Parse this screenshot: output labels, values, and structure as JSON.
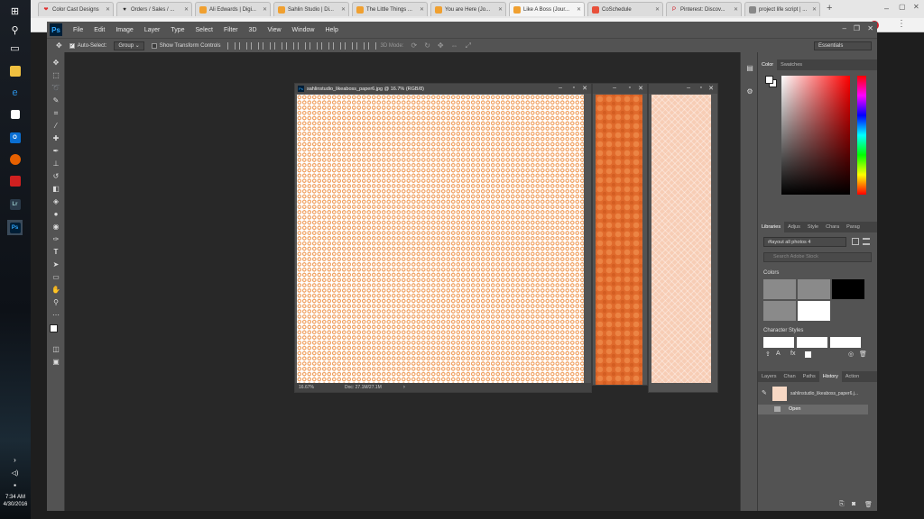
{
  "taskbar": {
    "time": "7:34 AM",
    "date": "4/30/2016",
    "apps": [
      "windows-start",
      "search",
      "task-view",
      "chrome",
      "edge",
      "store",
      "outlook",
      "firefox",
      "app-red",
      "lightroom",
      "photoshop"
    ],
    "lr_label": "Lr",
    "ps_label": "Ps"
  },
  "browser": {
    "tabs": [
      {
        "title": "Color Cast Designs",
        "fav": "❤",
        "fav_color": "#e03030"
      },
      {
        "title": "Orders / Sales / ...",
        "fav": "♥",
        "fav_color": "#222"
      },
      {
        "title": "Ali Edwards | Digi...",
        "fav": "",
        "fav_color": "#f0a030"
      },
      {
        "title": "Sahlin Studio | Di...",
        "fav": "",
        "fav_color": "#f0a030"
      },
      {
        "title": "The Little Things ...",
        "fav": "",
        "fav_color": "#f0a030"
      },
      {
        "title": "You are Here (Jo...",
        "fav": "",
        "fav_color": "#f0a030"
      },
      {
        "title": "Like A Boss (Jour...",
        "fav": "",
        "fav_color": "#f0a030"
      },
      {
        "title": "CoSchedule",
        "fav": "",
        "fav_color": "#e8503a"
      },
      {
        "title": "Pinterest: Discov...",
        "fav": "P",
        "fav_color": "#d01f2a"
      },
      {
        "title": "project life script | ...",
        "fav": "",
        "fav_color": "#888"
      }
    ]
  },
  "photoshop": {
    "logo": "Ps",
    "menu": [
      "File",
      "Edit",
      "Image",
      "Layer",
      "Type",
      "Select",
      "Filter",
      "3D",
      "View",
      "Window",
      "Help"
    ],
    "options": {
      "auto_select": "Auto-Select:",
      "group": "Group",
      "show_transform": "Show Transform Controls",
      "mode_3d": "3D Mode:",
      "workspace": "Essentials"
    },
    "document": {
      "title": "sahlinstudio_likeaboss_paper6.jpg @ 16.7% (RGB/8)",
      "zoom": "16.67%",
      "doc_info": "Doc: 27.1M/27.1M"
    },
    "color_panel": {
      "tabs": [
        "Color",
        "Swatches"
      ]
    },
    "libraries_panel": {
      "tabs": [
        "Libraries",
        "Adjus",
        "Style",
        "Chara",
        "Parag"
      ],
      "library_name": "#layout all photos 4",
      "search_placeholder": "Search Adobe Stock",
      "colors_label": "Colors",
      "char_styles_label": "Character Styles",
      "swatch_colors": [
        "#8a8a8a",
        "#8a8a8a",
        "#000000",
        "#8a8a8a",
        "#ffffff"
      ]
    },
    "history_panel": {
      "tabs": [
        "Layers",
        "Chan",
        "Paths",
        "History",
        "Action"
      ],
      "snapshot": "sahlinstudio_likeaboss_paper6.j...",
      "state": "Open"
    }
  },
  "colors": {
    "orange": "#e06a2c",
    "peach": "#f7cdb5",
    "ps_bg": "#535353"
  }
}
